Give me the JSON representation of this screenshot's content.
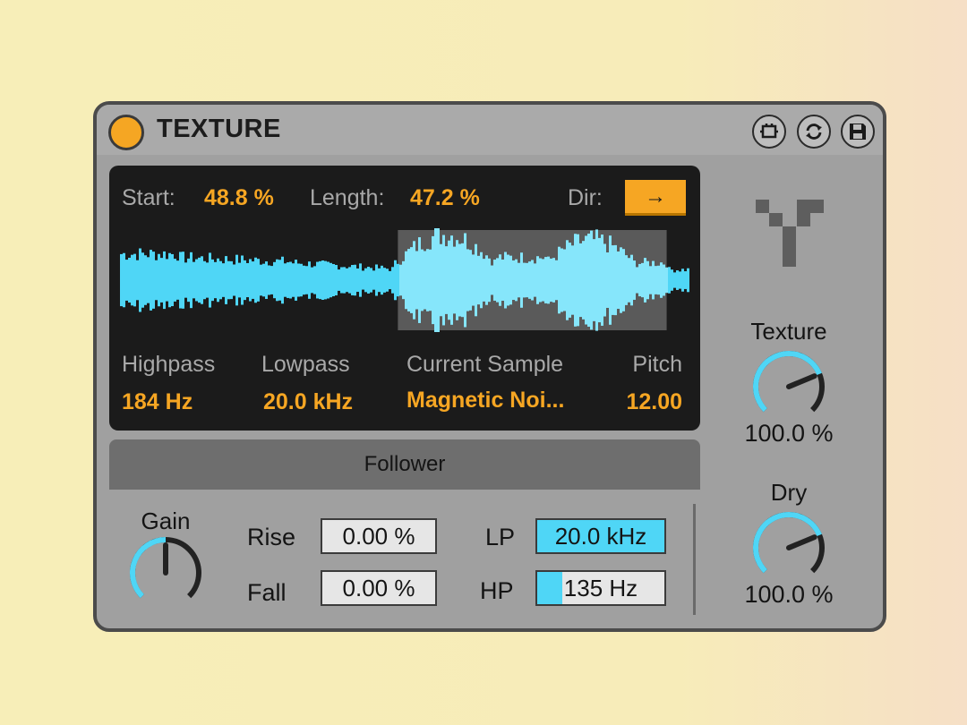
{
  "device": {
    "title": "TEXTURE",
    "power_color": "#f5a623",
    "buttons": [
      "hot-swap-icon",
      "refresh-icon",
      "save-icon"
    ]
  },
  "screen": {
    "start_label": "Start:",
    "start_value": "48.8 %",
    "length_label": "Length:",
    "length_value": "47.2 %",
    "dir_label": "Dir:",
    "dir_value": "→",
    "highpass_label": "Highpass",
    "highpass_value": "184 Hz",
    "lowpass_label": "Lowpass",
    "lowpass_value": "20.0 kHz",
    "sample_label": "Current Sample",
    "sample_value": "Magnetic Noi...",
    "pitch_label": "Pitch",
    "pitch_value": "12.00",
    "selection": {
      "start": 0.488,
      "length": 0.472
    },
    "colors": {
      "wave": "#4fd6f6",
      "selected_wave": "#86e6fb",
      "accent": "#f6a623"
    }
  },
  "follower": {
    "title": "Follower",
    "gain_label": "Gain",
    "gain_level": 0.5,
    "rise_label": "Rise",
    "rise_value": "0.00 %",
    "fall_label": "Fall",
    "fall_value": "0.00 %",
    "lp_label": "LP",
    "lp_value": "20.0 kHz",
    "lp_fill": 1.0,
    "hp_label": "HP",
    "hp_value": "135 Hz",
    "hp_fill": 0.2
  },
  "knobs": {
    "texture_label": "Texture",
    "texture_value": "100.0 %",
    "texture_level": 0.75,
    "dry_label": "Dry",
    "dry_value": "100.0 %",
    "dry_level": 0.75
  }
}
